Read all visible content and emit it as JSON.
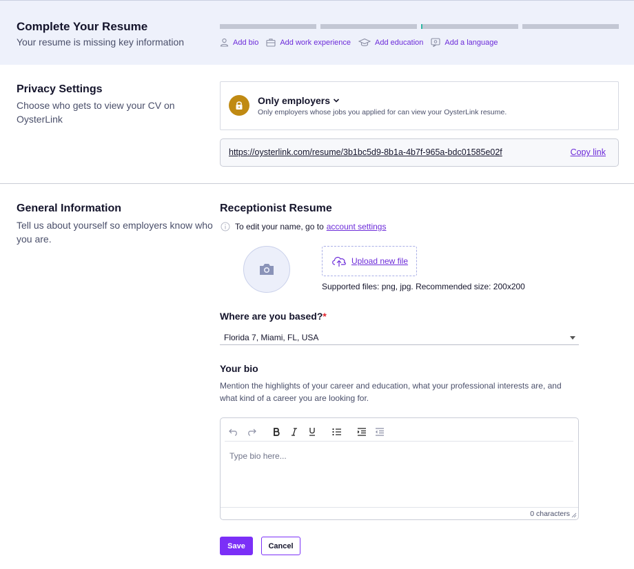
{
  "banner": {
    "title": "Complete Your Resume",
    "subtitle": "Your resume is missing key information",
    "progress_segments": 4,
    "actions": [
      {
        "label": "Add bio",
        "icon": "user-icon"
      },
      {
        "label": "Add work experience",
        "icon": "briefcase-icon"
      },
      {
        "label": "Add education",
        "icon": "graduation-cap-icon"
      },
      {
        "label": "Add a language",
        "icon": "language-icon"
      }
    ]
  },
  "privacy": {
    "title": "Privacy Settings",
    "description": "Choose who gets to view your CV on OysterLink",
    "option_title": "Only employers",
    "option_description": "Only employers whose jobs you applied for can view your OysterLink resume.",
    "url": "https://oysterlink.com/resume/3b1bc5d9-8b1a-4b7f-965a-bdc01585e02f",
    "copy_label": "Copy link"
  },
  "general": {
    "title": "General Information",
    "description": "Tell us about yourself so employers know who you are.",
    "resume_title": "Receptionist Resume",
    "edit_note": "To edit your name, go to",
    "account_settings_label": "account settings",
    "upload_label": "Upload new file",
    "supported_files": "Supported files: png, jpg. Recommended size: 200x200",
    "location_label": "Where are you based?",
    "required_mark": "*",
    "location_value": "Florida 7, Miami, FL, USA",
    "bio_label": "Your bio",
    "bio_description": "Mention the highlights of your career and education, what your professional interests are, and what kind of a career you are looking for.",
    "bio_placeholder": "Type bio here...",
    "char_count": "0 characters"
  },
  "buttons": {
    "save": "Save",
    "cancel": "Cancel"
  },
  "colors": {
    "accent": "#7b2ff7",
    "link": "#6c2bd9",
    "lock": "#c08a12",
    "banner_bg": "#eef1fb"
  }
}
